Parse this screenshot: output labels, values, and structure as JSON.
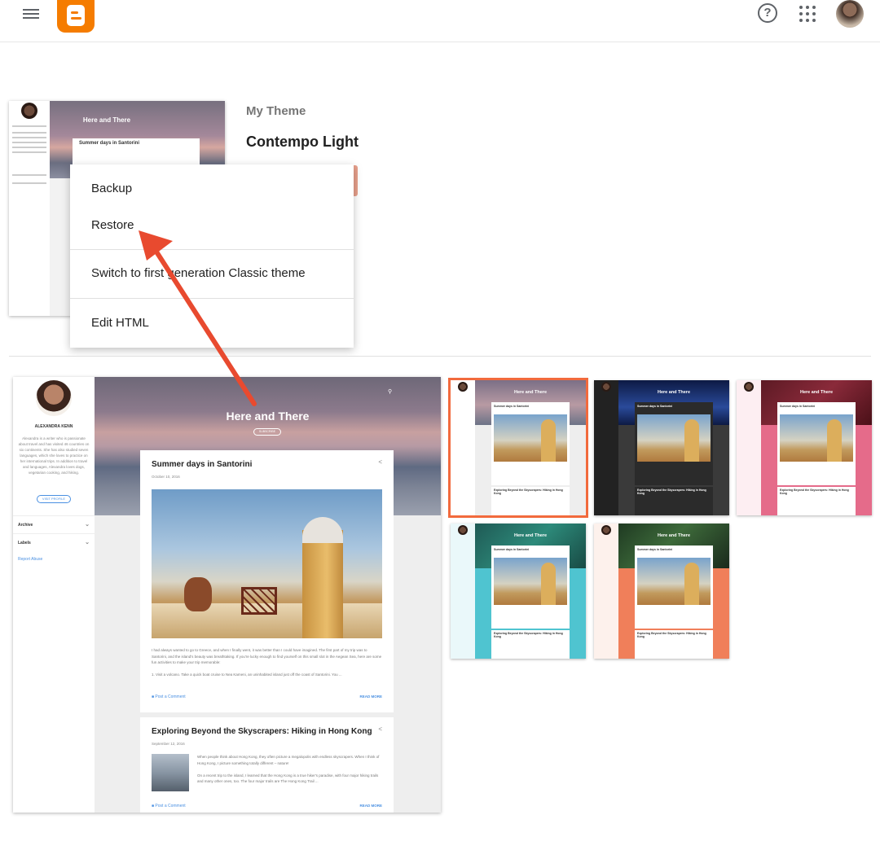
{
  "current": {
    "preview_title": "Here and There",
    "preview_post": "Summer days in Santorini",
    "label": "My Theme",
    "name": "Contempo Light"
  },
  "menu": {
    "items": [
      "Backup",
      "Restore",
      "Switch to first generation Classic theme",
      "Edit HTML"
    ]
  },
  "preview": {
    "blog_title": "Here and There",
    "subscribe": "SUBSCRIBE",
    "author": "ALEXANDRA KENN",
    "bio": "Alexandra is a writer who is passionate about travel and has visited 46 countries on six continents. She has also studied seven languages, which she loves to practice on her international trips. In addition to travel and languages, Alexandra loves dogs, vegetarian cooking, and hiking.",
    "visit_profile": "VISIT PROFILE",
    "archive": "Archive",
    "labels": "Labels",
    "report_abuse": "Report Abuse",
    "post1": {
      "title": "Summer days in Santorini",
      "date": "October 10, 2016",
      "text": "I had always wanted to go to Greece, and when I finally went, it was better than I could have imagined. The first part of my trip was to Santorini, and the island's beauty was breathtaking. If you're lucky enough to find yourself on this small slot in the Aegean Sea, here are some fun activities to make your trip memorable:",
      "text2": "1. Visit a volcano. Take a quick boat cruise to Nea Kameni, an uninhabited island just off the coast of Santorini. You ...",
      "comment": "Post a Comment",
      "read_more": "READ MORE"
    },
    "post2": {
      "title": "Exploring Beyond the Skyscrapers: Hiking in Hong Kong",
      "date": "September 12, 2016",
      "text": "When people think about Hong Kong, they often picture a megalopolis with endless skyscrapers. When I think of Hong Kong, I picture something totally different – nature!",
      "text2": "On a recent trip to the island, I learned that the Hong Kong is a true hiker's paradise, with four major hiking trails and many other ones, too. The four major trails are The Hong Kong Trail ...",
      "comment": "Post a Comment",
      "read_more": "READ MORE"
    }
  },
  "thumbnails": [
    {
      "title": "Here and There",
      "post": "Summer days in Santorini",
      "post2": "Exploring Beyond the Skyscrapers: Hiking in Hong Kong",
      "head": "#7b6f86",
      "bg": "#eeeeee"
    },
    {
      "title": "Here and There",
      "post": "Summer days in Santorini",
      "post2": "Exploring Beyond the Skyscrapers: Hiking in Hong Kong",
      "head": "#1b2a5c",
      "bg": "#3a3a3a"
    },
    {
      "title": "Here and There",
      "post": "Summer days in Santorini",
      "post2": "Exploring Beyond the Skyscrapers: Hiking in Hong Kong",
      "head": "#5c1a24",
      "bg": "#e56b8a"
    },
    {
      "title": "Here and There",
      "post": "Summer days in Santorini",
      "post2": "Exploring Beyond the Skyscrapers: Hiking in Hong Kong",
      "head": "#1f5a55",
      "bg": "#4fc4d0"
    },
    {
      "title": "Here and There",
      "post": "Summer days in Santorini",
      "post2": "Exploring Beyond the Skyscrapers: Hiking in Hong Kong",
      "head": "#1f3a22",
      "bg": "#f07f5a"
    }
  ],
  "colors": {
    "brand": "#f57c00",
    "selected": "#f26a3d",
    "arrow": "#e84a2f"
  }
}
